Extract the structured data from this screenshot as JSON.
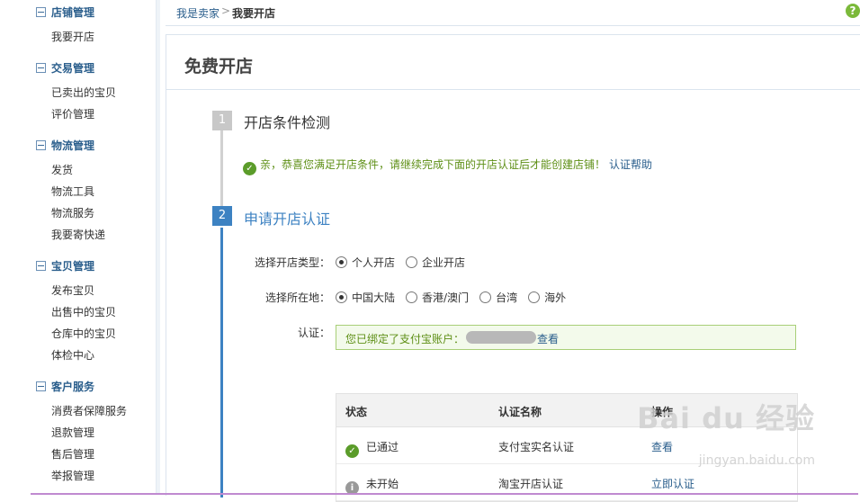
{
  "sidebar": {
    "groups": [
      {
        "title": "店铺管理",
        "items": [
          "我要开店"
        ]
      },
      {
        "title": "交易管理",
        "items": [
          "已卖出的宝贝",
          "评价管理"
        ]
      },
      {
        "title": "物流管理",
        "items": [
          "发货",
          "物流工具",
          "物流服务",
          "我要寄快递"
        ]
      },
      {
        "title": "宝贝管理",
        "items": [
          "发布宝贝",
          "出售中的宝贝",
          "仓库中的宝贝",
          "体检中心"
        ]
      },
      {
        "title": "客户服务",
        "items": [
          "消费者保障服务",
          "退款管理",
          "售后管理",
          "举报管理"
        ]
      }
    ]
  },
  "breadcrumb": {
    "link": "我是卖家",
    "sep": ">",
    "current": "我要开店"
  },
  "help_icon": "?",
  "page_title": "免费开店",
  "step1": {
    "num": "1",
    "title": "开店条件检测",
    "message": "亲，恭喜您满足开店条件，请继续完成下面的开店认证后才能创建店铺！",
    "help_link": "认证帮助"
  },
  "step2": {
    "num": "2",
    "title": "申请开店认证"
  },
  "form": {
    "type_label": "选择开店类型：",
    "type_options": [
      "个人开店",
      "企业开店"
    ],
    "location_label": "选择所在地：",
    "location_options": [
      "中国大陆",
      "香港/澳门",
      "台湾",
      "海外"
    ],
    "cert_label": "认证：",
    "cert_text": "您已绑定了支付宝账户：",
    "cert_link": "查看"
  },
  "table": {
    "headers": [
      "状态",
      "认证名称",
      "操作"
    ],
    "rows": [
      {
        "status": "已通过",
        "name": "支付宝实名认证",
        "action": "查看"
      },
      {
        "status": "未开始",
        "name": "淘宝开店认证",
        "action": "立即认证"
      }
    ]
  },
  "watermark": {
    "main": "Bai du 经验",
    "sub": "jingyan.baidu.com"
  },
  "colors": {
    "accent": "#3d82c2",
    "success": "#5b9c2a",
    "link": "#2a5e8c"
  }
}
